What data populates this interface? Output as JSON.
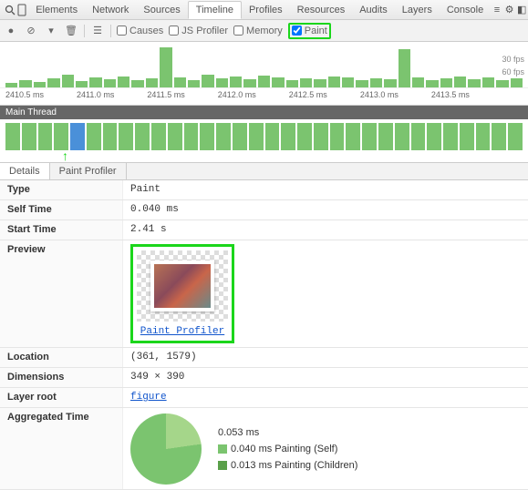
{
  "tabs": [
    "Elements",
    "Network",
    "Sources",
    "Timeline",
    "Profiles",
    "Resources",
    "Audits",
    "Layers",
    "Console"
  ],
  "active_tab": "Timeline",
  "toolbar": {
    "causes": "Causes",
    "jsprofiler": "JS Profiler",
    "memory": "Memory",
    "paint": "Paint"
  },
  "fps30": "30 fps",
  "fps60": "60 fps",
  "xaxis": [
    "2410.5 ms",
    "2411.0 ms",
    "2411.5 ms",
    "2412.0 ms",
    "2412.5 ms",
    "2413.0 ms",
    "2413.5 ms"
  ],
  "mainthread_label": "Main Thread",
  "detail_tabs": [
    "Details",
    "Paint Profiler"
  ],
  "props": {
    "type_k": "Type",
    "type_v": "Paint",
    "self_k": "Self Time",
    "self_v": "0.040 ms",
    "start_k": "Start Time",
    "start_v": "2.41 s",
    "preview_k": "Preview",
    "paint_profiler_link": "Paint Profiler",
    "loc_k": "Location",
    "loc_v": "(361, 1579)",
    "dim_k": "Dimensions",
    "dim_v": "349 × 390",
    "layer_k": "Layer root",
    "layer_v": "figure",
    "agg_k": "Aggregated Time",
    "agg_total": "0.053 ms",
    "agg_self": "0.040 ms Painting (Self)",
    "agg_children": "0.013 ms Painting (Children)"
  }
}
